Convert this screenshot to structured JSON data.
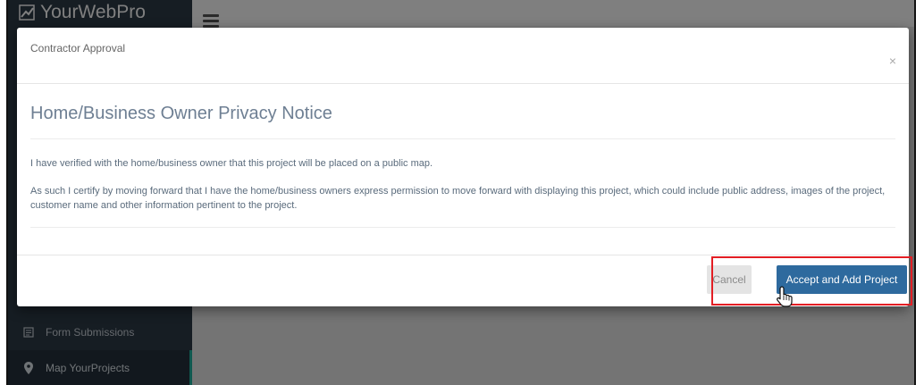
{
  "app": {
    "brand": "YourWebPro",
    "sidebar": {
      "items": [
        {
          "label": "Form Submissions",
          "icon": "form-icon"
        },
        {
          "label": "Map YourProjects",
          "icon": "map-pin-icon"
        }
      ]
    }
  },
  "modal": {
    "title": "Contractor Approval",
    "close": "×",
    "heading": "Home/Business Owner Privacy Notice",
    "paragraph1": "I have verified with the home/business owner that this project will be placed on a public map.",
    "paragraph2": "As such I certify by moving forward that I have the home/business owners express permission to move forward with displaying this project, which could include public address, images of the project, customer name and other information pertinent to the project.",
    "cancel_label": "Cancel",
    "accept_label": "Accept and Add Project"
  },
  "colors": {
    "sidebar_bg": "#2d3a46",
    "accent_primary": "#2e6a9e",
    "highlight": "#e31e24",
    "active_indicator": "#21b3a0"
  }
}
